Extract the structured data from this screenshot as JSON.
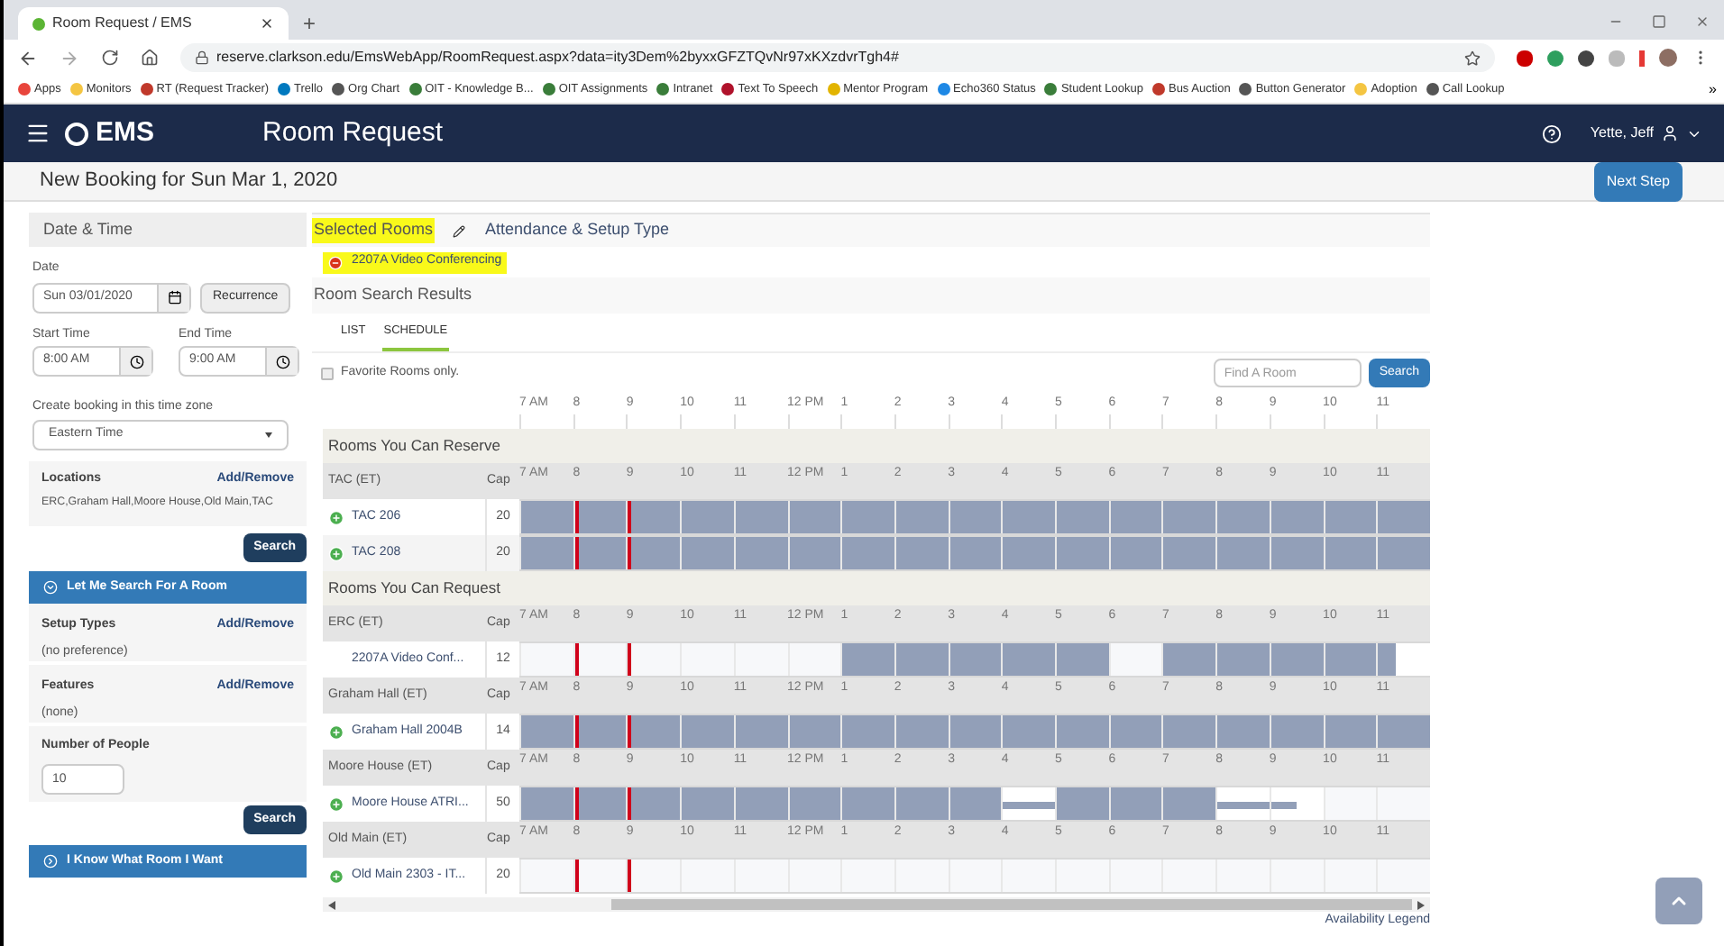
{
  "browser": {
    "tab_title": "Room Request / EMS",
    "new_tab": "+",
    "url": "reserve.clarkson.edu/EmsWebApp/RoomRequest.aspx?data=ity3Dem%2byxxGFZTQvNr97xKXzdvrTgh4#",
    "bookmarks": [
      {
        "label": "Apps",
        "color": "#e8453c"
      },
      {
        "label": "Monitors",
        "color": "#f4c542"
      },
      {
        "label": "RT (Request Tracker)",
        "color": "#c0392b"
      },
      {
        "label": "Trello",
        "color": "#0079bf"
      },
      {
        "label": "Org Chart",
        "color": "#555555"
      },
      {
        "label": "OIT - Knowledge B...",
        "color": "#3a7d3a"
      },
      {
        "label": "OIT Assignments",
        "color": "#3a7d3a"
      },
      {
        "label": "Intranet",
        "color": "#3a7d3a"
      },
      {
        "label": "Text To Speech",
        "color": "#b0122b"
      },
      {
        "label": "Mentor Program",
        "color": "#e2b400"
      },
      {
        "label": "Echo360 Status",
        "color": "#1e88e5"
      },
      {
        "label": "Student Lookup",
        "color": "#3a7d3a"
      },
      {
        "label": "Bus Auction",
        "color": "#c0392b"
      },
      {
        "label": "Button Generator",
        "color": "#555555"
      },
      {
        "label": "Adoption",
        "color": "#f4c542"
      },
      {
        "label": "Call Lookup",
        "color": "#555555"
      }
    ],
    "more": "»"
  },
  "header": {
    "logo": "EMS",
    "title": "Room Request",
    "user": "Yette, Jeff"
  },
  "page": {
    "title": "New Booking for Sun Mar 1, 2020",
    "next_button": "Next Step"
  },
  "sidebar": {
    "title": "Date & Time",
    "date_label": "Date",
    "date": "Sun 03/01/2020",
    "recurrence": "Recurrence",
    "start_label": "Start Time",
    "start": "8:00 AM",
    "end_label": "End Time",
    "end": "9:00 AM",
    "tz_label": "Create booking in this time zone",
    "tz": "Eastern Time",
    "locations_label": "Locations",
    "locations_link": "Add/Remove",
    "locations": "ERC,Graham Hall,Moore House,Old Main,TAC",
    "search1": "Search",
    "panel1": "Let Me Search For A Room",
    "setup_label": "Setup Types",
    "setup_link": "Add/Remove",
    "setup": "(no preference)",
    "features_label": "Features",
    "features_link": "Add/Remove",
    "features": "(none)",
    "people_label": "Number of People",
    "people": "10",
    "search2": "Search",
    "panel2": "I Know What Room I Want"
  },
  "steps": [
    {
      "label": "Selected Rooms",
      "selected": true
    },
    {
      "label": "Attendance & Setup Type",
      "selected": false
    }
  ],
  "selected_rooms": [
    {
      "name": "2207A Video Conferencing"
    }
  ],
  "results": {
    "title": "Room Search Results",
    "tabs": [
      {
        "label": "LIST",
        "selected": false
      },
      {
        "label": "SCHEDULE",
        "selected": true
      }
    ],
    "favorites": {
      "label": "Favorite Rooms only.",
      "checked": false
    },
    "find_placeholder": "Find A Room",
    "search_button": "Search",
    "hours": [
      "7 AM",
      "8",
      "9",
      "10",
      "11",
      "12 PM",
      "1",
      "2",
      "3",
      "4",
      "5",
      "6",
      "7",
      "8",
      "9",
      "10",
      "11"
    ],
    "sections": [
      {
        "title": "Rooms You Can Reserve",
        "groups": [
          {
            "building": "TAC (ET)",
            "cap_label": "Cap",
            "hours": [
              "7 AM",
              "8",
              "9",
              "10",
              "11",
              "12 PM",
              "1",
              "2",
              "3",
              "4",
              "5",
              "6",
              "7",
              "8",
              "9",
              "10",
              "11"
            ],
            "rooms": [
              {
                "name": "TAC 206",
                "cap": "20",
                "addable": true,
                "slots": [
                  {
                    "kind": "busy"
                  },
                  {
                    "kind": "busy"
                  },
                  {
                    "kind": "busy"
                  },
                  {
                    "kind": "busy"
                  },
                  {
                    "kind": "busy"
                  },
                  {
                    "kind": "busy"
                  },
                  {
                    "kind": "busy"
                  },
                  {
                    "kind": "busy"
                  },
                  {
                    "kind": "busy"
                  },
                  {
                    "kind": "busy"
                  },
                  {
                    "kind": "busy"
                  },
                  {
                    "kind": "busy"
                  },
                  {
                    "kind": "busy"
                  },
                  {
                    "kind": "busy"
                  },
                  {
                    "kind": "busy"
                  },
                  {
                    "kind": "busy"
                  },
                  {
                    "kind": "busy"
                  }
                ]
              },
              {
                "name": "TAC 208",
                "cap": "20",
                "addable": true,
                "slots": [
                  {
                    "kind": "busy"
                  },
                  {
                    "kind": "busy"
                  },
                  {
                    "kind": "busy"
                  },
                  {
                    "kind": "busy"
                  },
                  {
                    "kind": "busy"
                  },
                  {
                    "kind": "busy"
                  },
                  {
                    "kind": "busy"
                  },
                  {
                    "kind": "busy"
                  },
                  {
                    "kind": "busy"
                  },
                  {
                    "kind": "busy"
                  },
                  {
                    "kind": "busy"
                  },
                  {
                    "kind": "busy"
                  },
                  {
                    "kind": "busy"
                  },
                  {
                    "kind": "busy"
                  },
                  {
                    "kind": "busy"
                  },
                  {
                    "kind": "busy"
                  },
                  {
                    "kind": "busy"
                  }
                ]
              }
            ]
          }
        ]
      },
      {
        "title": "Rooms You Can Request",
        "groups": [
          {
            "building": "ERC (ET)",
            "cap_label": "Cap",
            "hours": [
              "7 AM",
              "8",
              "9",
              "10",
              "11",
              "12 PM",
              "1",
              "2",
              "3",
              "4",
              "5",
              "6",
              "7",
              "8",
              "9",
              "10",
              "11"
            ],
            "rooms": [
              {
                "name": "2207A Video Conf...",
                "cap": "12",
                "addable": false,
                "slots": [
                  {
                    "kind": "free"
                  },
                  {
                    "kind": "free"
                  },
                  {
                    "kind": "free"
                  },
                  {
                    "kind": "free"
                  },
                  {
                    "kind": "free"
                  },
                  {
                    "kind": "free"
                  },
                  {
                    "kind": "busy"
                  },
                  {
                    "kind": "busy"
                  },
                  {
                    "kind": "busy"
                  },
                  {
                    "kind": "busy"
                  },
                  {
                    "kind": "busy"
                  },
                  {
                    "kind": "free"
                  },
                  {
                    "kind": "busy"
                  },
                  {
                    "kind": "busy"
                  },
                  {
                    "kind": "busy"
                  },
                  {
                    "kind": "busy"
                  },
                  {
                    "kind": "partial"
                  }
                ]
              }
            ]
          },
          {
            "building": "Graham Hall (ET)",
            "cap_label": "Cap",
            "hours": [
              "7 AM",
              "8",
              "9",
              "10",
              "11",
              "12 PM",
              "1",
              "2",
              "3",
              "4",
              "5",
              "6",
              "7",
              "8",
              "9",
              "10",
              "11"
            ],
            "rooms": [
              {
                "name": "Graham Hall 2004B",
                "cap": "14",
                "addable": true,
                "slots": [
                  {
                    "kind": "busy"
                  },
                  {
                    "kind": "busy"
                  },
                  {
                    "kind": "busy"
                  },
                  {
                    "kind": "busy"
                  },
                  {
                    "kind": "busy"
                  },
                  {
                    "kind": "busy"
                  },
                  {
                    "kind": "busy"
                  },
                  {
                    "kind": "busy"
                  },
                  {
                    "kind": "busy"
                  },
                  {
                    "kind": "busy"
                  },
                  {
                    "kind": "busy"
                  },
                  {
                    "kind": "busy"
                  },
                  {
                    "kind": "busy"
                  },
                  {
                    "kind": "busy"
                  },
                  {
                    "kind": "busy"
                  },
                  {
                    "kind": "busy"
                  },
                  {
                    "kind": "busy"
                  }
                ]
              }
            ]
          },
          {
            "building": "Moore House (ET)",
            "cap_label": "Cap",
            "hours": [
              "7 AM",
              "8",
              "9",
              "10",
              "11",
              "12 PM",
              "1",
              "2",
              "3",
              "4",
              "5",
              "6",
              "7",
              "8",
              "9",
              "10",
              "11"
            ],
            "rooms": [
              {
                "name": "Moore House ATRI...",
                "cap": "50",
                "addable": true,
                "slots": [
                  {
                    "kind": "busy"
                  },
                  {
                    "kind": "busy"
                  },
                  {
                    "kind": "busy"
                  },
                  {
                    "kind": "busy"
                  },
                  {
                    "kind": "busy"
                  },
                  {
                    "kind": "busy"
                  },
                  {
                    "kind": "busy"
                  },
                  {
                    "kind": "busy"
                  },
                  {
                    "kind": "busy"
                  },
                  {
                    "kind": "thin"
                  },
                  {
                    "kind": "busy"
                  },
                  {
                    "kind": "busy"
                  },
                  {
                    "kind": "busy"
                  },
                  {
                    "kind": "thin"
                  },
                  {
                    "kind": "thin-half"
                  },
                  {
                    "kind": "free"
                  },
                  {
                    "kind": "free"
                  }
                ]
              }
            ]
          },
          {
            "building": "Old Main (ET)",
            "cap_label": "Cap",
            "hours": [
              "7 AM",
              "8",
              "9",
              "10",
              "11",
              "12 PM",
              "1",
              "2",
              "3",
              "4",
              "5",
              "6",
              "7",
              "8",
              "9",
              "10",
              "11"
            ],
            "rooms": [
              {
                "name": "Old Main 2303 - IT...",
                "cap": "20",
                "addable": true,
                "slots": [
                  {
                    "kind": "free"
                  },
                  {
                    "kind": "free"
                  },
                  {
                    "kind": "free"
                  },
                  {
                    "kind": "free"
                  },
                  {
                    "kind": "free"
                  },
                  {
                    "kind": "free"
                  },
                  {
                    "kind": "free"
                  },
                  {
                    "kind": "free"
                  },
                  {
                    "kind": "free"
                  },
                  {
                    "kind": "free"
                  },
                  {
                    "kind": "free"
                  },
                  {
                    "kind": "free"
                  },
                  {
                    "kind": "free"
                  },
                  {
                    "kind": "free"
                  },
                  {
                    "kind": "free"
                  },
                  {
                    "kind": "free"
                  },
                  {
                    "kind": "free"
                  }
                ]
              }
            ]
          }
        ]
      }
    ],
    "legend": "Availability Legend"
  }
}
